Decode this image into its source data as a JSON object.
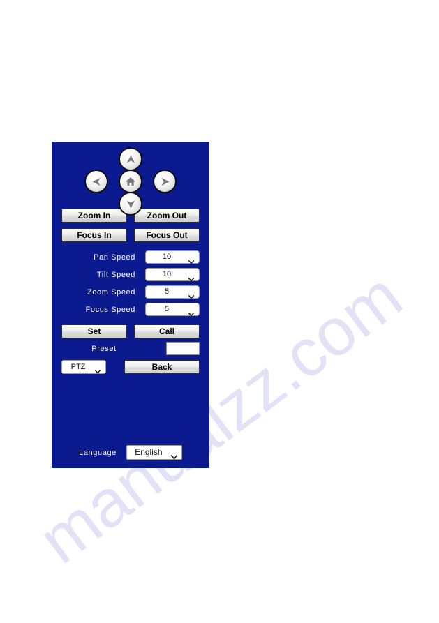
{
  "watermark": {
    "text": "manualzz.com"
  },
  "panel": {
    "background_color": "#0b1a8e",
    "dpad": {
      "up_label": "pan-up",
      "left_label": "pan-left",
      "home_label": "home",
      "right_label": "pan-right",
      "down_label": "pan-down"
    },
    "zoom_row": {
      "zoom_in": "Zoom In",
      "zoom_out": "Zoom Out"
    },
    "focus_row": {
      "focus_in": "Focus In",
      "focus_out": "Focus Out"
    },
    "speeds": [
      {
        "label": "Pan Speed",
        "value": "10"
      },
      {
        "label": "Tilt Speed",
        "value": "10"
      },
      {
        "label": "Zoom Speed",
        "value": "5"
      },
      {
        "label": "Focus Speed",
        "value": "5"
      }
    ],
    "preset_actions": {
      "set": "Set",
      "call": "Call"
    },
    "preset": {
      "label": "Preset",
      "value": "",
      "placeholder": ""
    },
    "mode_row": {
      "mode_value": "PTZ",
      "back": "Back"
    },
    "language": {
      "label": "Language",
      "value": "English"
    }
  }
}
